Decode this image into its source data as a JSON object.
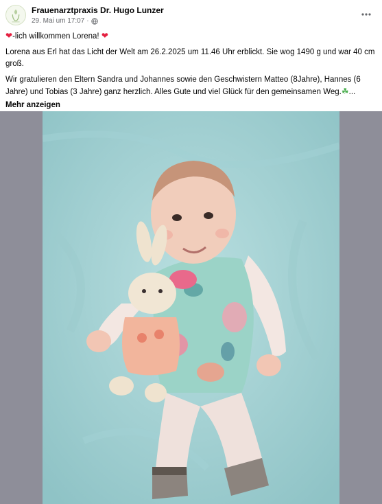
{
  "post": {
    "page_name": "Frauenarztpraxis Dr. Hugo Lunzer",
    "date": "29. Mai um 17:07",
    "separator": "·",
    "privacy_icon": "globe-icon",
    "more_icon": "more-options-icon",
    "line1_heart_icon": "red-heart-icon",
    "line1_text": "-lich willkommen Lorena!",
    "line2": "Lorena aus Erl hat das Licht der Welt am 26.2.2025 um 11.46 Uhr erblickt. Sie wog 1490 g und war 40 cm groß.",
    "line3": "Wir gratulieren den Eltern Sandra und Johannes sowie den Geschwistern Matteo (8Jahre), Hannes (6 Jahre) und Tobias (3 Jahre) ganz herzlich. Alles Gute und viel Glück für den gemeinsamen Weg.",
    "line3_icon": "four-leaf-clover-icon",
    "ellipsis": "...",
    "see_more": "Mehr anzeigen"
  },
  "media": {
    "image_description_icon": "baby-photo"
  },
  "colors": {
    "background": "#ffffff",
    "media_bg": "#8e8e99",
    "heart": "#e41e3f",
    "secondary_text": "#65676b"
  }
}
